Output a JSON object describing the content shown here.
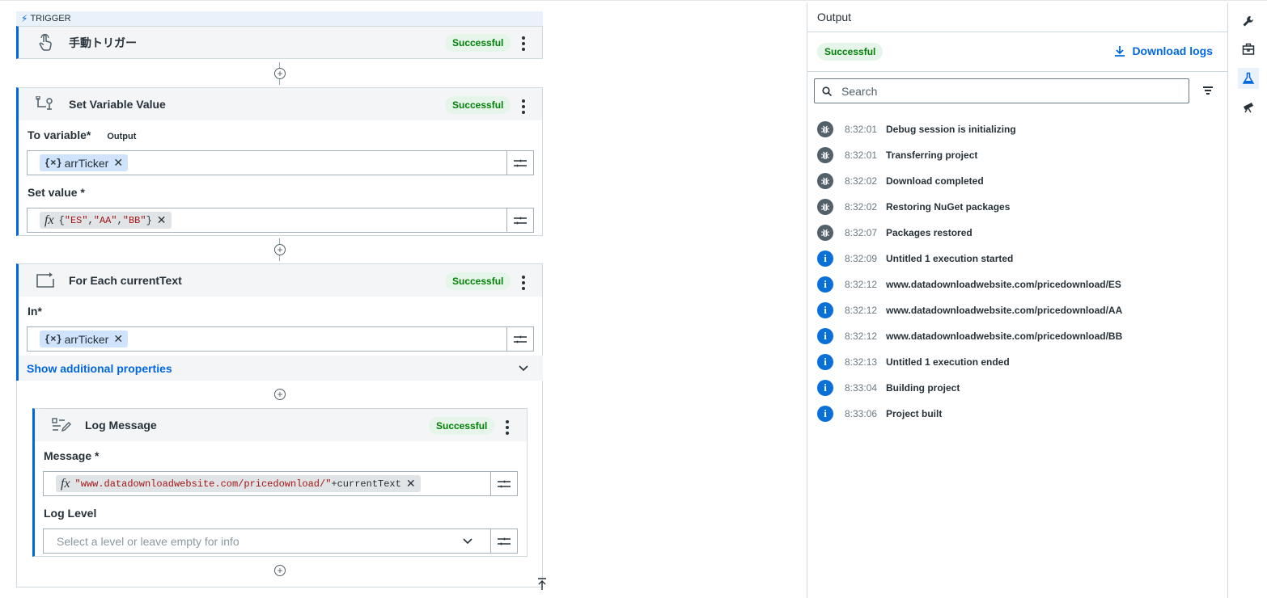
{
  "trigger_tag": "TRIGGER",
  "cards": {
    "trigger": {
      "title": "手動トリガー",
      "status": "Successful"
    },
    "set_variable": {
      "title": "Set Variable Value",
      "status": "Successful",
      "to_variable_label": "To variable*",
      "to_variable_sublabel": "Output",
      "to_variable_value": "arrTicker",
      "set_value_label": "Set value *",
      "set_value_open": "{",
      "set_value_s1": "\"ES\"",
      "set_value_c1": ",",
      "set_value_s2": "\"AA\"",
      "set_value_c2": ",",
      "set_value_s3": "\"BB\"",
      "set_value_close": "}"
    },
    "for_each": {
      "title": "For Each currentText",
      "status": "Successful",
      "in_label": "In*",
      "in_value": "arrTicker",
      "show_more": "Show additional properties"
    },
    "log_message": {
      "title": "Log Message",
      "status": "Successful",
      "message_label": "Message *",
      "message_string": "\"www.datadownloadwebsite.com/pricedownload/\"",
      "message_rest": "+currentText",
      "log_level_label": "Log Level",
      "log_level_placeholder": "Select a level or leave empty for info"
    }
  },
  "output_panel": {
    "title": "Output",
    "status": "Successful",
    "download_label": "Download logs",
    "search_placeholder": "Search",
    "logs": [
      {
        "type": "debug",
        "time": "8:32:01",
        "message": "Debug session is initializing"
      },
      {
        "type": "debug",
        "time": "8:32:01",
        "message": "Transferring project"
      },
      {
        "type": "debug",
        "time": "8:32:02",
        "message": "Download completed"
      },
      {
        "type": "debug",
        "time": "8:32:02",
        "message": "Restoring NuGet packages"
      },
      {
        "type": "debug",
        "time": "8:32:07",
        "message": "Packages restored"
      },
      {
        "type": "info",
        "time": "8:32:09",
        "message": "Untitled 1 execution started"
      },
      {
        "type": "info",
        "time": "8:32:12",
        "message": "www.datadownloadwebsite.com/pricedownload/ES"
      },
      {
        "type": "info",
        "time": "8:32:12",
        "message": "www.datadownloadwebsite.com/pricedownload/AA"
      },
      {
        "type": "info",
        "time": "8:32:12",
        "message": "www.datadownloadwebsite.com/pricedownload/BB"
      },
      {
        "type": "info",
        "time": "8:32:13",
        "message": "Untitled 1 execution ended"
      },
      {
        "type": "info",
        "time": "8:33:04",
        "message": "Building project"
      },
      {
        "type": "info",
        "time": "8:33:06",
        "message": "Project built"
      }
    ]
  },
  "right_rail": [
    "wrench-icon",
    "toolbox-icon",
    "flask-icon",
    "telescope-icon"
  ],
  "colors": {
    "accent": "#0067df",
    "success_text": "#038108",
    "success_bg": "#e6f5e9",
    "info": "#0a6fd6",
    "debug": "#526069"
  }
}
